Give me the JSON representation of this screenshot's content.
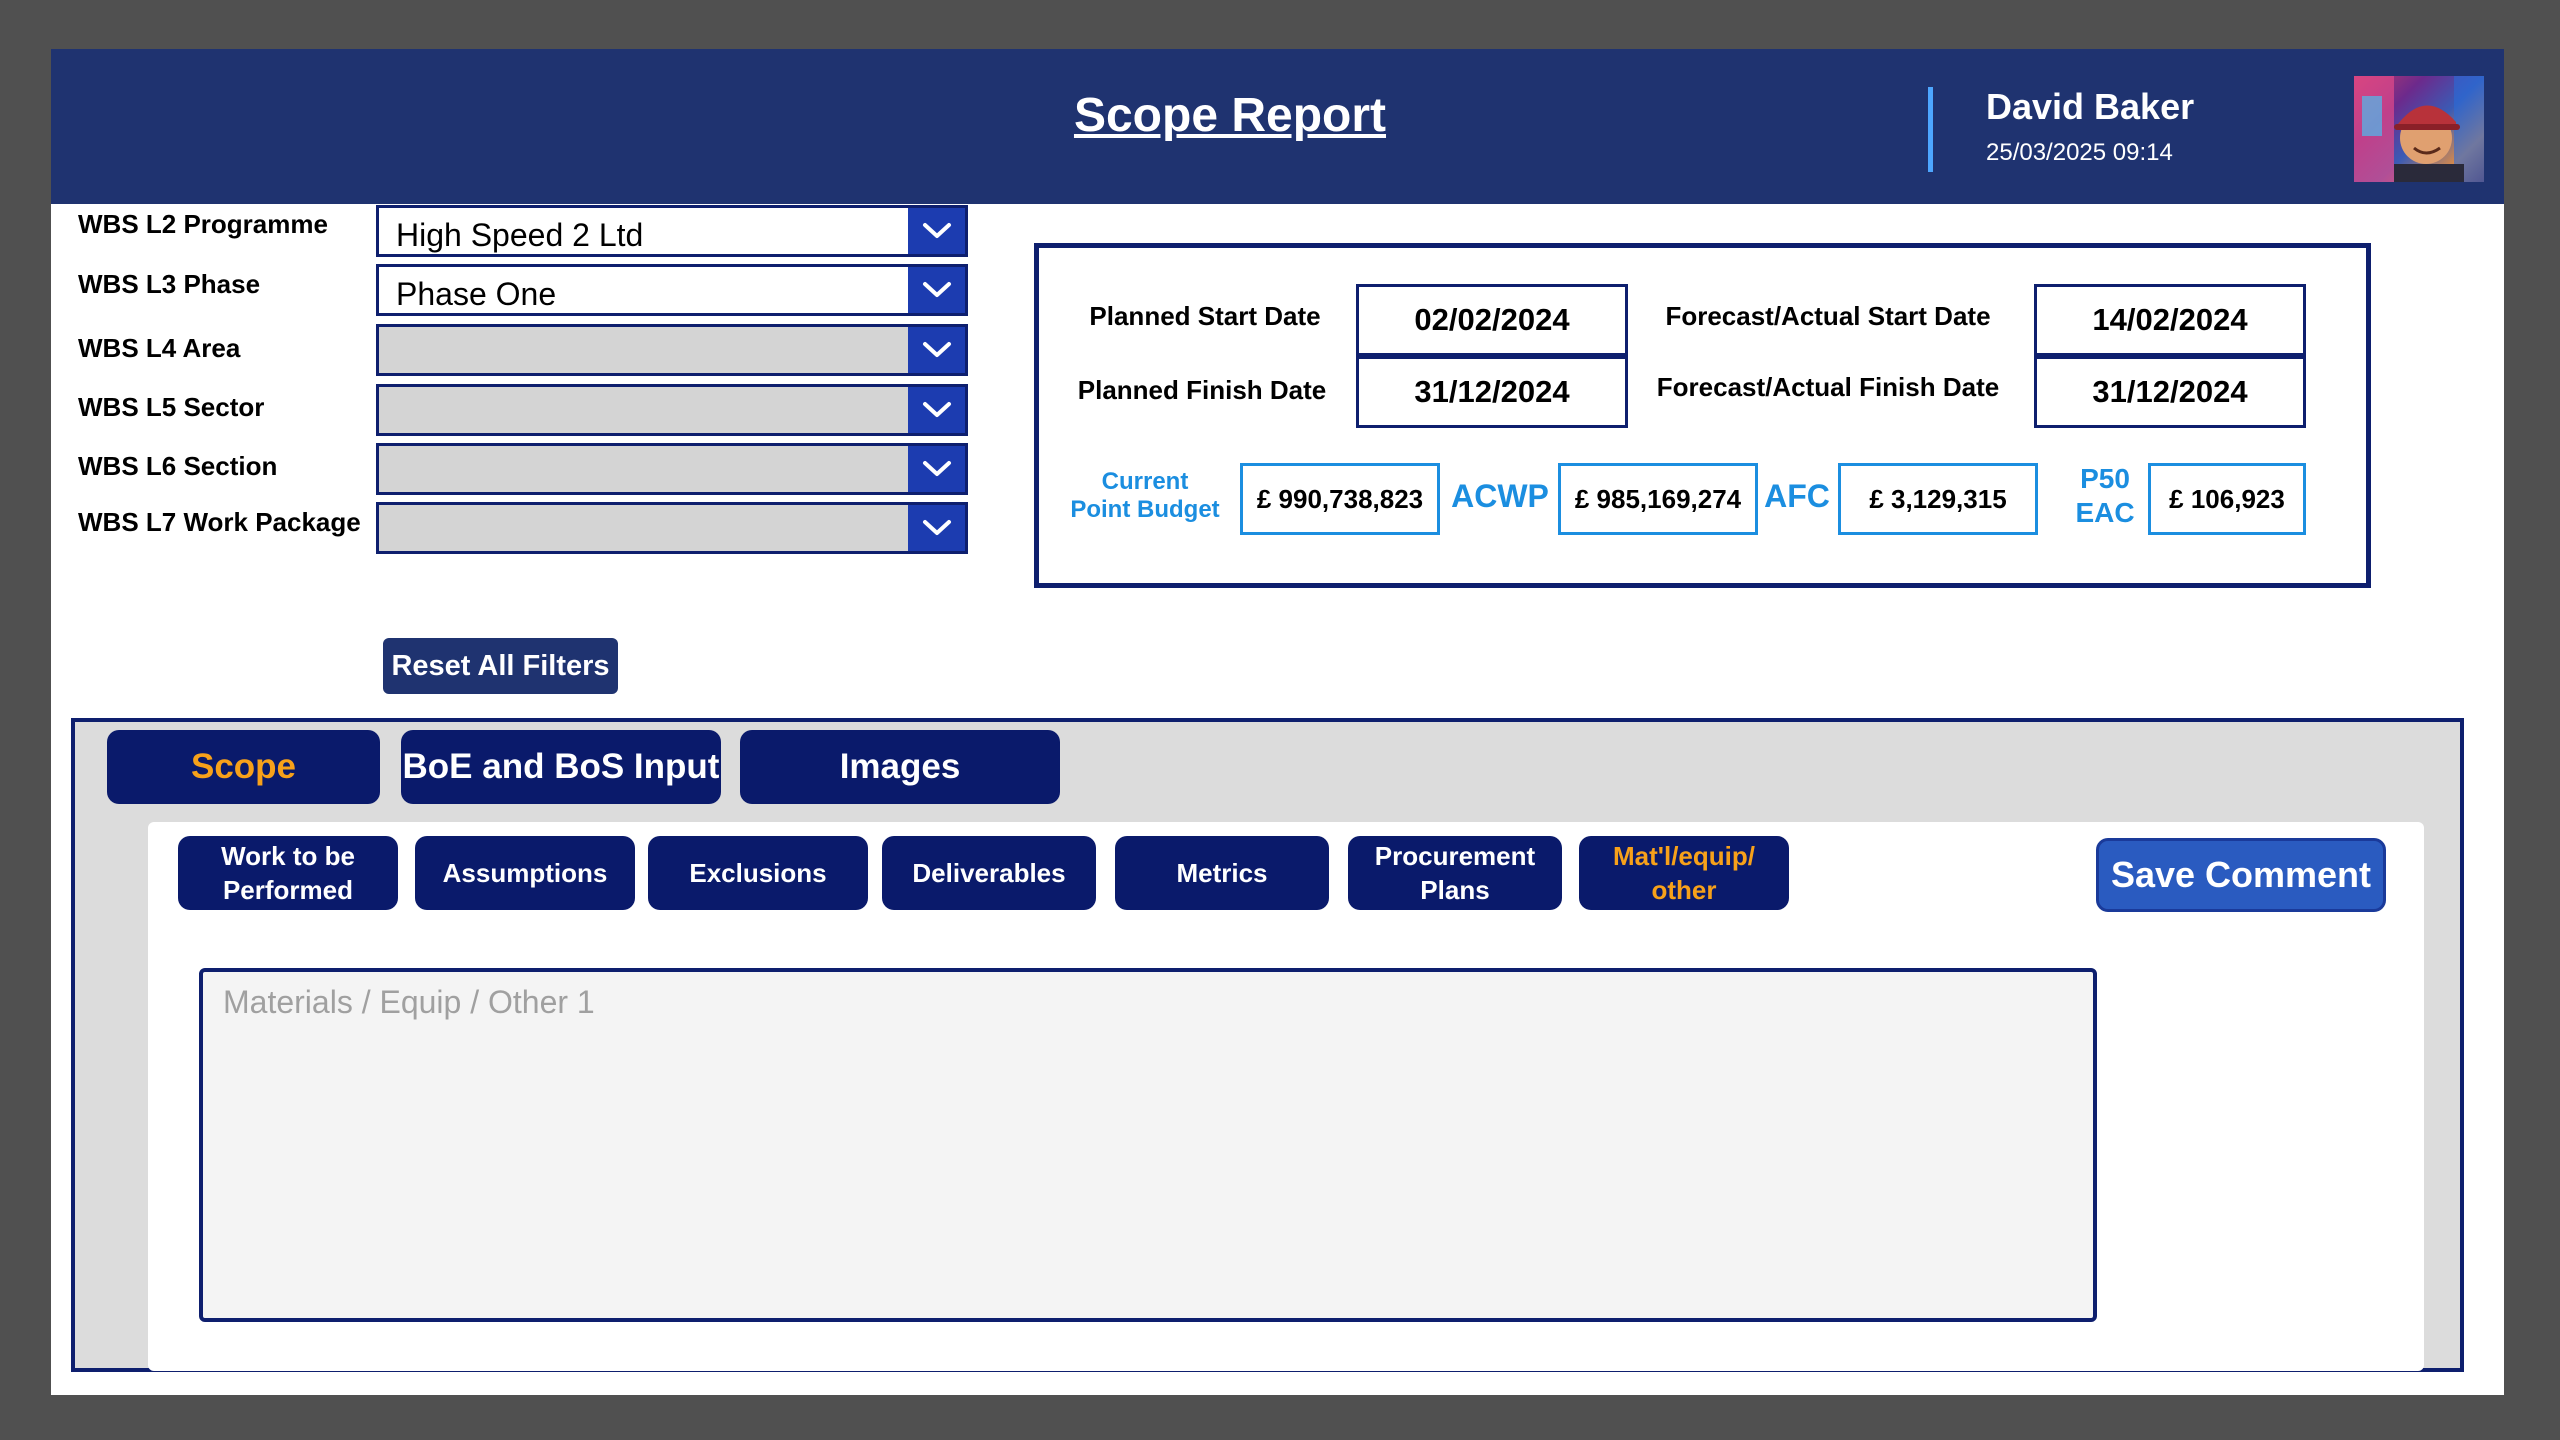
{
  "header": {
    "title": "Scope Report",
    "user_name": "David Baker",
    "datetime": "25/03/2025 09:14",
    "background": "#1f3370"
  },
  "filters": [
    {
      "label": "WBS L2 Programme",
      "value": "High Speed 2 Ltd"
    },
    {
      "label": "WBS L3 Phase",
      "value": "Phase One"
    },
    {
      "label": "WBS L4 Area",
      "value": ""
    },
    {
      "label": "WBS L5 Sector",
      "value": ""
    },
    {
      "label": "WBS L6 Section",
      "value": ""
    },
    {
      "label": "WBS L7 Work Package",
      "value": ""
    }
  ],
  "reset_button": "Reset All Filters",
  "summary": {
    "planned_start_label": "Planned Start Date",
    "planned_start": "02/02/2024",
    "planned_finish_label": "Planned Finish Date",
    "planned_finish": "31/12/2024",
    "forecast_start_label": "Forecast/Actual Start Date",
    "forecast_start": "14/02/2024",
    "forecast_finish_label": "Forecast/Actual Finish Date",
    "forecast_finish": "31/12/2024",
    "budget_label_line1": "Current",
    "budget_label_line2": "Point Budget",
    "budget_value": "£ 990,738,823",
    "acwp_label": "ACWP",
    "acwp_value": "£ 985,169,274",
    "afc_label": "AFC",
    "afc_value": "£ 3,129,315",
    "eac_label_line1": "P50",
    "eac_label_line2": "EAC",
    "eac_value": "£ 106,923"
  },
  "main_tabs": [
    {
      "label": "Scope",
      "active": true
    },
    {
      "label": "BoE and BoS Input",
      "active": false
    },
    {
      "label": "Images",
      "active": false
    }
  ],
  "sub_tabs": [
    {
      "line1": "Work to be",
      "line2": "Performed",
      "active": false
    },
    {
      "line1": "Assumptions",
      "line2": "",
      "active": false
    },
    {
      "line1": "Exclusions",
      "line2": "",
      "active": false
    },
    {
      "line1": "Deliverables",
      "line2": "",
      "active": false
    },
    {
      "line1": "Metrics",
      "line2": "",
      "active": false
    },
    {
      "line1": "Procurement",
      "line2": "Plans",
      "active": false
    },
    {
      "line1": "Mat'l/equip/",
      "line2": "other",
      "active": true
    }
  ],
  "save_button": "Save Comment",
  "comment": {
    "placeholder": "Materials / Equip / Other 1",
    "value": ""
  },
  "colors": {
    "navy": "#0a1a6b",
    "accent_orange": "#f7a11a",
    "accent_blue": "#1b8ee0",
    "dropdown_chevron": "#1c3cb0"
  },
  "icons": {
    "dropdown": "chevron-down-icon",
    "avatar": "user-photo"
  }
}
